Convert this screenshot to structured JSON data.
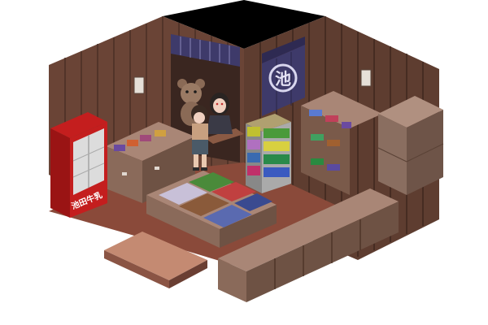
{
  "scene": {
    "type": "isometric-pixel-room",
    "colors": {
      "background": "#ffffff",
      "ceiling": "#000000",
      "wall_wood": "#6e4a3a",
      "wall_plank_dark": "#4a2f25",
      "floor_tile": "#9a5a44",
      "floor_tile_light": "#c88a6e",
      "crate": "#8a6a5a",
      "crate_top": "#a98676",
      "curtain": "#3e3a6a",
      "fridge_red": "#c41e1e",
      "fridge_white": "#dcdcdc"
    }
  },
  "noren_curtain": {
    "text": "池"
  },
  "vending_fridge": {
    "label": "池田牛乳"
  },
  "characters": [
    {
      "name": "shopkeeper-girl"
    },
    {
      "name": "child-customer"
    },
    {
      "name": "teddy-bear"
    }
  ],
  "items": [
    {
      "name": "candy-display-shelf"
    },
    {
      "name": "snack-bins"
    },
    {
      "name": "notice-paper-left"
    },
    {
      "name": "notice-paper-right"
    }
  ]
}
